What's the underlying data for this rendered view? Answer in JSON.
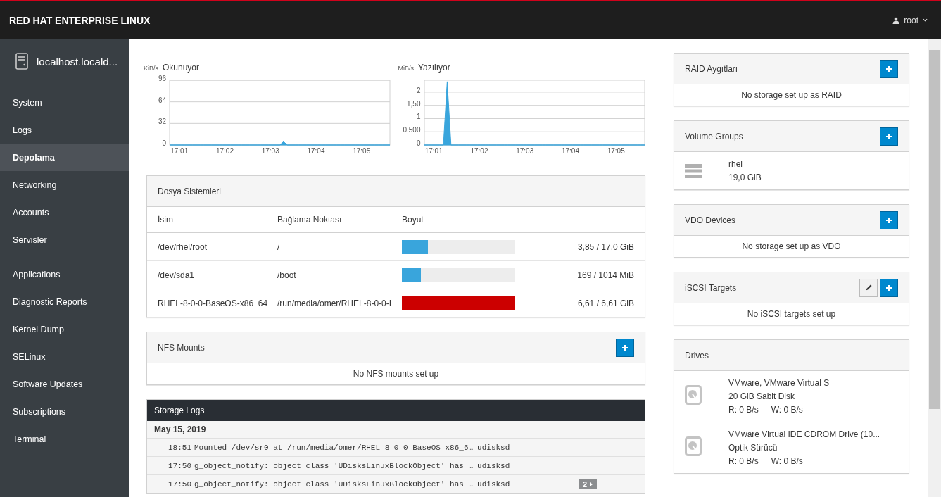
{
  "header": {
    "brand": "RED HAT ENTERPRISE LINUX",
    "user": "root"
  },
  "sidebar": {
    "host": "localhost.locald...",
    "groups": [
      {
        "items": [
          {
            "label": "System",
            "selected": false
          },
          {
            "label": "Logs",
            "selected": false
          },
          {
            "label": "Depolama",
            "selected": true
          },
          {
            "label": "Networking",
            "selected": false
          },
          {
            "label": "Accounts",
            "selected": false
          },
          {
            "label": "Servisler",
            "selected": false
          }
        ]
      },
      {
        "items": [
          {
            "label": "Applications",
            "selected": false
          },
          {
            "label": "Diagnostic Reports",
            "selected": false
          },
          {
            "label": "Kernel Dump",
            "selected": false
          },
          {
            "label": "SELinux",
            "selected": false
          },
          {
            "label": "Software Updates",
            "selected": false
          },
          {
            "label": "Subscriptions",
            "selected": false
          },
          {
            "label": "Terminal",
            "selected": false
          }
        ]
      }
    ]
  },
  "charts": [
    {
      "chart_data": {
        "type": "area",
        "title": "Okunuyor",
        "ylabel": "KiB/s",
        "categories": [
          null,
          null,
          null,
          "17:01",
          null,
          null,
          null,
          null,
          null,
          null,
          null,
          null,
          null,
          null,
          null,
          "17:02",
          null,
          null,
          null,
          null,
          null,
          null,
          null,
          null,
          null,
          null,
          null,
          "17:03",
          null,
          null,
          null,
          null,
          null,
          null,
          null,
          null,
          null,
          null,
          null,
          "17:04",
          null,
          null,
          null,
          null,
          null,
          null,
          null,
          null,
          null,
          null,
          null,
          "17:05",
          null,
          null,
          null,
          null,
          null,
          null,
          null
        ],
        "values": [
          0,
          0,
          0,
          0,
          0,
          0,
          0,
          0,
          0,
          0,
          0,
          0,
          0,
          0,
          0,
          0,
          0,
          0,
          0,
          0,
          0,
          0,
          0,
          0,
          0,
          0,
          0,
          0,
          0,
          0,
          5,
          0,
          0,
          0,
          0,
          0,
          0,
          0,
          0,
          0,
          0,
          0,
          0,
          0,
          0,
          0,
          0,
          0,
          0,
          0,
          0,
          0,
          0,
          0,
          0,
          0,
          0,
          0,
          0
        ],
        "ylim": [
          0,
          96
        ],
        "yticks": [
          0,
          32,
          64,
          96
        ],
        "grid": true
      }
    },
    {
      "chart_data": {
        "type": "area",
        "title": "Yazılıyor",
        "ylabel": "MiB/s",
        "categories": [
          null,
          null,
          null,
          "17:01",
          null,
          null,
          null,
          null,
          null,
          null,
          null,
          null,
          null,
          null,
          null,
          "17:02",
          null,
          null,
          null,
          null,
          null,
          null,
          null,
          null,
          null,
          null,
          null,
          "17:03",
          null,
          null,
          null,
          null,
          null,
          null,
          null,
          null,
          null,
          null,
          null,
          "17:04",
          null,
          null,
          null,
          null,
          null,
          null,
          null,
          null,
          null,
          null,
          null,
          "17:05",
          null,
          null,
          null,
          null,
          null,
          null,
          null
        ],
        "values": [
          0,
          0,
          0,
          0,
          0,
          0,
          2.4,
          0,
          0,
          0,
          0,
          0,
          0,
          0,
          0,
          0,
          0,
          0,
          0,
          0,
          0,
          0,
          0,
          0,
          0,
          0,
          0,
          0,
          0,
          0,
          0,
          0,
          0,
          0,
          0,
          0,
          0,
          0,
          0,
          0,
          0,
          0,
          0,
          0,
          0,
          0,
          0,
          0,
          0,
          0,
          0,
          0,
          0,
          0,
          0,
          0,
          0,
          0,
          0
        ],
        "ylim": [
          0,
          2.45
        ],
        "yticks": [
          0,
          {
            "value": 0.5,
            "label": "0,500"
          },
          1,
          {
            "value": 1.5,
            "label": "1,50"
          },
          2
        ],
        "grid": true
      }
    }
  ],
  "filesystems": {
    "title": "Dosya Sistemleri",
    "columns": [
      "İsim",
      "Bağlama Noktası",
      "Boyut"
    ],
    "rows": [
      {
        "name": "/dev/rhel/root",
        "mount": "/",
        "level": 0.23,
        "size": "3,85 / 17,0 GiB"
      },
      {
        "name": "/dev/sda1",
        "mount": "/boot",
        "level": 0.17,
        "size": "169 / 1014 MiB"
      },
      {
        "name": "RHEL-8-0-0-BaseOS-x86_64",
        "mount": "/run/media/omer/RHEL-8-0-0-I",
        "level": 1.0,
        "size": "6,61 / 6,61 GiB"
      }
    ]
  },
  "nfs": {
    "title": "NFS Mounts",
    "empty": "No NFS mounts set up"
  },
  "logs": {
    "title": "Storage Logs",
    "date": "May 15, 2019",
    "rows": [
      {
        "time": "18:51",
        "message": "Mounted /dev/sr0 at /run/media/omer/RHEL-8-0-0-BaseOS-x86_6…",
        "source": "udisksd"
      },
      {
        "time": "17:50",
        "message": "g_object_notify: object class 'UDisksLinuxBlockObject' has …",
        "source": "udisksd"
      },
      {
        "time": "17:50",
        "message": "g_object_notify: object class 'UDisksLinuxBlockObject' has …",
        "source": "udisksd",
        "count": "2"
      }
    ]
  },
  "panels": [
    {
      "kind": "empty",
      "title": "RAID Aygıtları",
      "editable": false,
      "text": "No storage set up as RAID"
    },
    {
      "kind": "groups",
      "title": "Volume Groups",
      "editable": false,
      "items": [
        {
          "name": "rhel",
          "size": "19,0 GiB"
        }
      ]
    },
    {
      "kind": "empty",
      "title": "VDO Devices",
      "editable": false,
      "text": "No storage set up as VDO"
    },
    {
      "kind": "empty",
      "title": "iSCSI Targets",
      "editable": true,
      "text": "No iSCSI targets set up"
    },
    {
      "kind": "drives",
      "title": "Drives",
      "items": [
        {
          "name": "VMware, VMware Virtual S",
          "type": "20 GiB Sabit Disk",
          "read": "R: 0 B/s",
          "write": "W: 0 B/s"
        },
        {
          "name": "VMware Virtual IDE CDROM Drive (10...",
          "type": "Optik Sürücü",
          "read": "R: 0 B/s",
          "write": "W: 0 B/s"
        }
      ]
    }
  ]
}
